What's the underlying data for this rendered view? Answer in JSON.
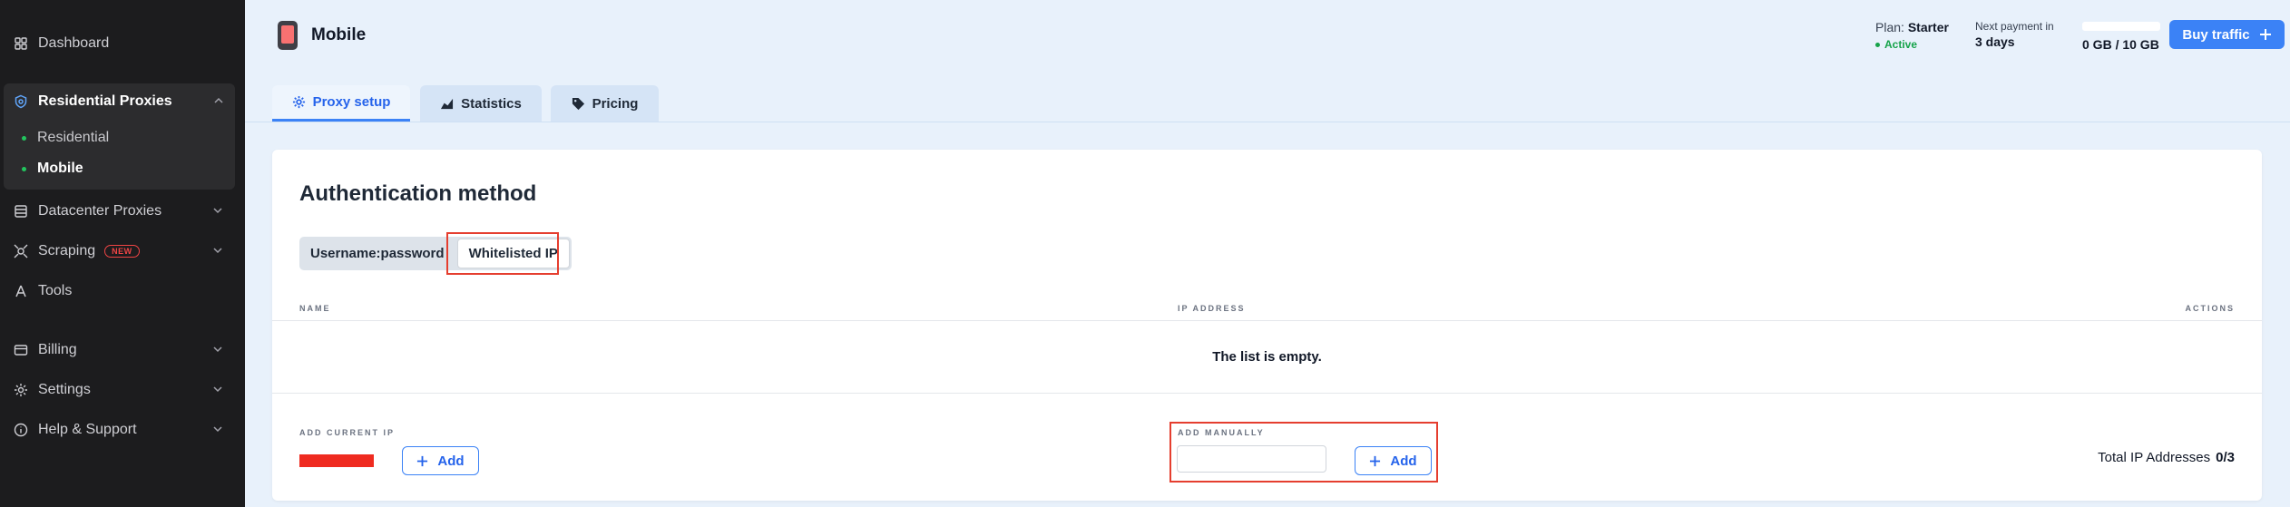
{
  "sidebar": {
    "items": [
      {
        "label": "Dashboard"
      },
      {
        "label": "Residential Proxies"
      },
      {
        "label": "Residential"
      },
      {
        "label": "Mobile"
      },
      {
        "label": "Datacenter Proxies"
      },
      {
        "label": "Scraping",
        "badge": "NEW"
      },
      {
        "label": "Tools"
      },
      {
        "label": "Billing"
      },
      {
        "label": "Settings"
      },
      {
        "label": "Help & Support"
      }
    ]
  },
  "header": {
    "title": "Mobile",
    "plan_label": "Plan:",
    "plan_value": "Starter",
    "status": "Active",
    "payment_label": "Next payment in",
    "payment_value": "3 days",
    "traffic": "0 GB / 10 GB",
    "traffic_fraction": 0,
    "buy_label": "Buy traffic"
  },
  "tabs": [
    {
      "label": "Proxy setup",
      "active": true
    },
    {
      "label": "Statistics",
      "active": false
    },
    {
      "label": "Pricing",
      "active": false
    }
  ],
  "auth": {
    "title": "Authentication method",
    "options": [
      "Username:password",
      "Whitelisted IP"
    ],
    "selected": "Whitelisted IP"
  },
  "table": {
    "columns": [
      "NAME",
      "IP ADDRESS",
      "ACTIONS"
    ],
    "empty_message": "The list is empty."
  },
  "add": {
    "current_label": "ADD CURRENT IP",
    "manual_label": "ADD MANUALLY",
    "add_label": "Add",
    "manual_value": "",
    "total_label": "Total IP Addresses",
    "total_value": "0/3"
  },
  "colors": {
    "accent": "#3b82f6",
    "active_status": "#16a34a",
    "highlight": "#e53e2f"
  }
}
